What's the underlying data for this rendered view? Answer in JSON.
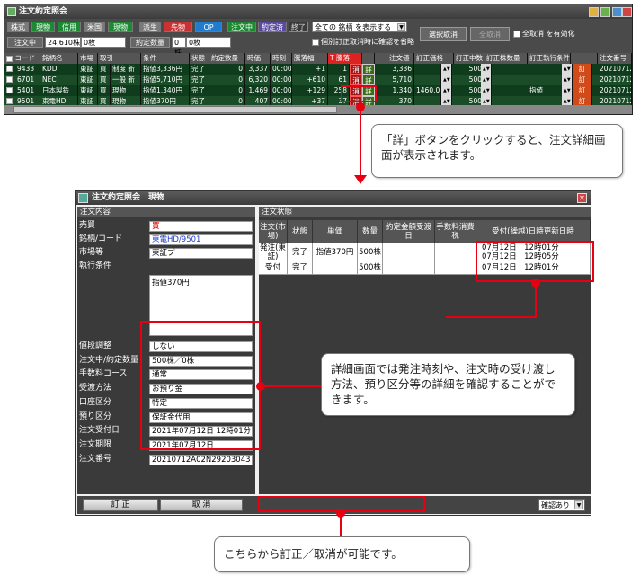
{
  "main_window": {
    "title": "注文約定照会",
    "toolbar": {
      "row1": [
        "株式",
        "現物",
        "信用",
        "米国",
        "現物",
        "派生",
        "先物",
        "OP"
      ],
      "status_buttons": [
        "注文中",
        "約定済",
        "終了"
      ],
      "filter_select": "全ての 銘柄 を表示する",
      "select_cancel": "選択取消",
      "cancel_all": "全取消",
      "cancel_all_enable": "全取消 を有効化",
      "order_qty_label": "注文中",
      "order_qty_value": "24,610株",
      "order_qty_value2": "0枚",
      "exec_qty_label": "約定数量",
      "exec_qty_value": "0株",
      "exec_qty_value2": "0枚",
      "confirm_skip": "個別訂正取消時に確認を省略"
    },
    "columns": [
      "コード",
      "銘柄名",
      "市場",
      "取引",
      "条件",
      "状態",
      "約定数量",
      "時価",
      "時刻",
      "騰落幅",
      "T 騰落",
      "",
      "",
      "注文値",
      "訂正価格",
      "訂正中数",
      "訂正株数量",
      "訂正執行条件",
      "",
      "注文番号"
    ],
    "rows": [
      {
        "code": "9433",
        "name": "KDDI",
        "market": "東証",
        "side": "買",
        "type": "制度 新",
        "cond": "指値3,336円",
        "status": "完了",
        "exec": "0",
        "price": "3,337",
        "time": "00:00",
        "change": "+1",
        "tchange": "1",
        "cancel": "消",
        "detail": "詳",
        "order_price": "3,336",
        "qty": "500",
        "teisei": "訂",
        "order_no": "20210712"
      },
      {
        "code": "6701",
        "name": "NEC",
        "market": "東証",
        "side": "買",
        "type": "一般 新",
        "cond": "指値5,710円",
        "status": "完了",
        "exec": "0",
        "price": "6,320",
        "time": "00:00",
        "change": "+610",
        "tchange": "61",
        "cancel": "消",
        "detail": "詳",
        "order_price": "5,710",
        "qty": "500",
        "teisei": "訂",
        "order_no": "20210712"
      },
      {
        "code": "5401",
        "name": "日本製鉄",
        "market": "東証",
        "side": "買",
        "type": "現物",
        "cond": "指値1,340円",
        "status": "完了",
        "exec": "0",
        "price": "1,469",
        "time": "00:00",
        "change": "+129",
        "tchange": "258",
        "cancel": "消",
        "detail": "詳",
        "order_price": "1,340",
        "revise": "1460.0",
        "qty": "500",
        "exec_cond": "指値",
        "teisei": "訂",
        "order_no": "20210712"
      },
      {
        "code": "9501",
        "name": "東電HD",
        "market": "東証",
        "side": "買",
        "type": "現物",
        "cond": "指値370円",
        "status": "完了",
        "exec": "0",
        "price": "407",
        "time": "00:00",
        "change": "+37",
        "tchange": "37",
        "cancel": "消",
        "detail": "詳",
        "order_price": "370",
        "qty": "500",
        "teisei": "訂",
        "order_no": "20210712"
      }
    ]
  },
  "callouts": {
    "top": "「詳」ボタンをクリックすると、注文詳細画面が表示されます。",
    "middle": "詳細画面では発注時刻や、注文時の受け渡し方法、預り区分等の詳細を確認することができます。",
    "bottom": "こちらから訂正／取消が可能です。"
  },
  "detail_window": {
    "title": "注文約定照会　現物",
    "left_header": "注文内容",
    "right_header": "注文状態",
    "fields_top": [
      {
        "label": "売買",
        "value": "買"
      },
      {
        "label": "銘柄/コード",
        "value": "東電HD/9501"
      },
      {
        "label": "市場等",
        "value": "東証プ"
      },
      {
        "label": "執行条件",
        "value": "指値370円"
      }
    ],
    "fields_bottom": [
      {
        "label": "値段調整",
        "value": "しない"
      },
      {
        "label": "注文中/約定数量",
        "value": "500株／0株"
      },
      {
        "label": "手数料コース",
        "value": "通常"
      },
      {
        "label": "受渡方法",
        "value": "お預り金"
      },
      {
        "label": "口座区分",
        "value": "特定"
      },
      {
        "label": "預り区分",
        "value": "保証金代用"
      },
      {
        "label": "注文受付日",
        "value": "2021年07月12日 12時01分"
      },
      {
        "label": "注文期限",
        "value": "2021年07月12日"
      },
      {
        "label": "注文番号",
        "value": "20210712A02N29203043"
      }
    ],
    "status_columns": [
      "注文(市場)",
      "状態",
      "単価",
      "数量",
      "約定金額受渡日",
      "手数料消費税",
      "受付(繰越)日時更新日時"
    ],
    "status_rows": [
      {
        "order": "発注(東証)",
        "state": "完了",
        "price": "指値370円",
        "qty": "500株",
        "amount": "",
        "fee": "",
        "time1": "07月12日　12時01分",
        "time2": "07月12日　12時05分"
      },
      {
        "order": "受付",
        "state": "完了",
        "price": "",
        "qty": "500株",
        "amount": "",
        "fee": "",
        "time1": "07月12日　12時01分",
        "time2": ""
      }
    ],
    "revise_button": "訂 正",
    "cancel_button": "取 消",
    "confirm_select": "確認あり"
  }
}
